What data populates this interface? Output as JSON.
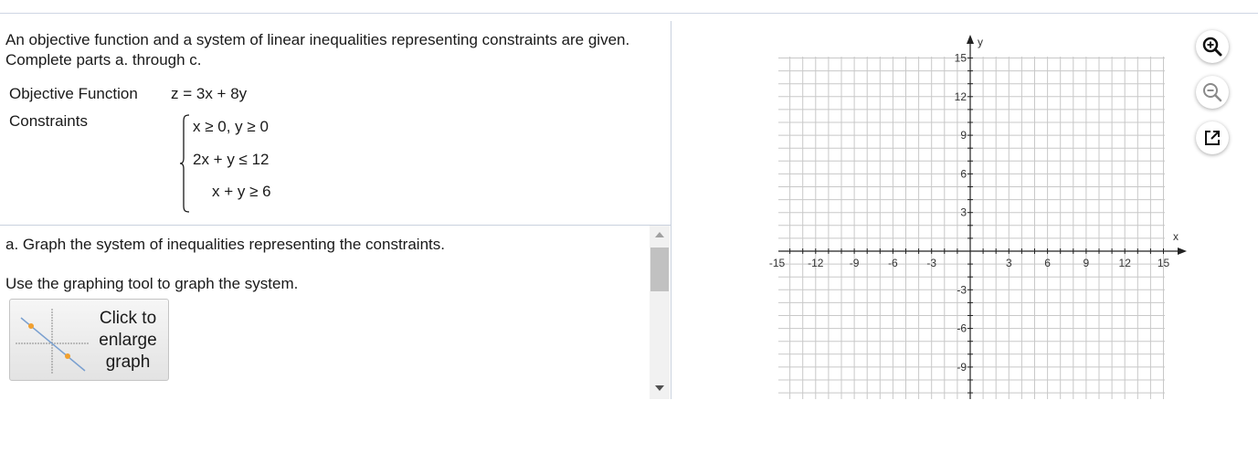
{
  "problem": {
    "statement": "An objective function and a system of linear inequalities representing constraints are given. Complete parts a. through c.",
    "objective_label": "Objective Function",
    "objective_value": "z = 3x + 8y",
    "constraints_label": "Constraints",
    "constraints": [
      "x ≥ 0, y ≥ 0",
      "2x + y ≤ 12",
      "x + y ≥ 6"
    ]
  },
  "part_a": {
    "instruction": "a. Graph the system of inequalities representing the constraints.",
    "tool_hint": "Use the graphing tool to graph the system.",
    "enlarge_button": [
      "Click to",
      "enlarge",
      "graph"
    ]
  },
  "graph": {
    "x_axis_name": "x",
    "y_axis_name": "y",
    "x_ticks": [
      "-15",
      "-12",
      "-9",
      "-6",
      "-3",
      "3",
      "6",
      "9",
      "12",
      "15"
    ],
    "y_ticks": [
      "15",
      "12",
      "9",
      "6",
      "3",
      "-3",
      "-6",
      "-9"
    ],
    "x_range": [
      -15,
      15
    ],
    "y_range": [
      -15,
      15
    ],
    "grid_step": 1,
    "label_step": 3,
    "grid": true
  },
  "toolbar": {
    "icons": [
      "zoom-in-icon",
      "zoom-out-icon",
      "pop-out-icon"
    ]
  }
}
